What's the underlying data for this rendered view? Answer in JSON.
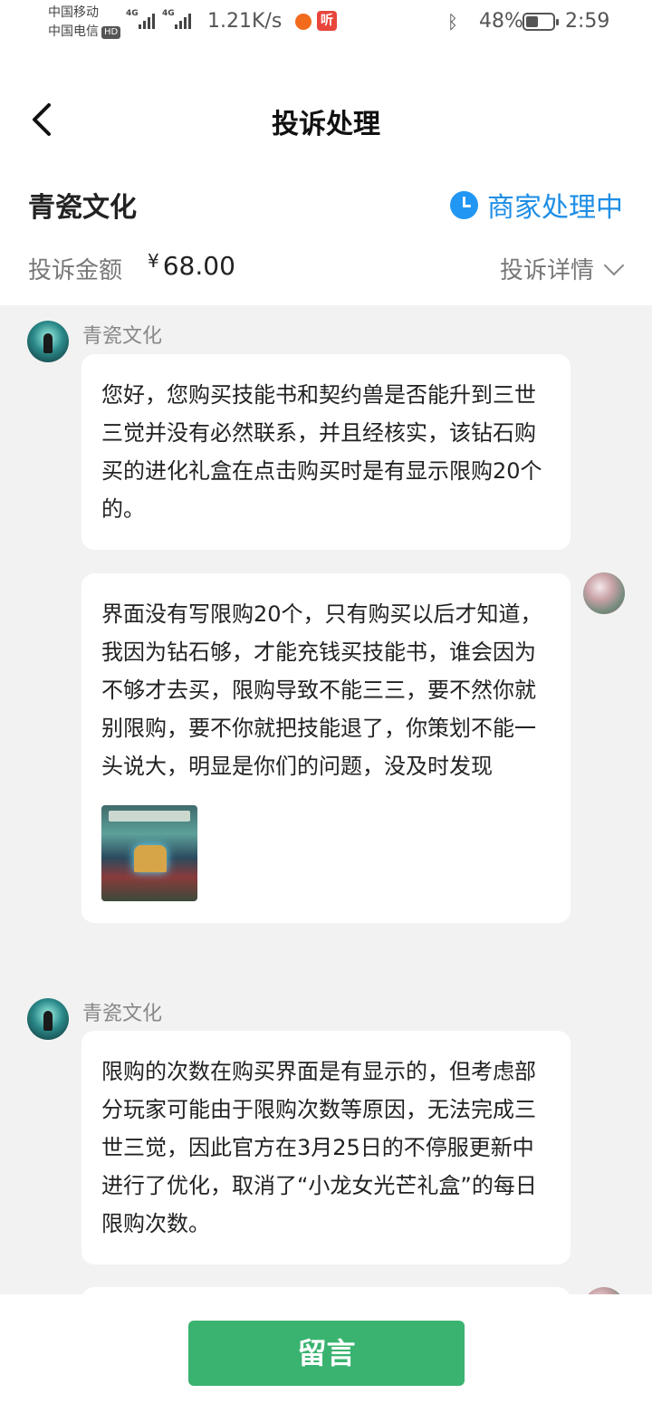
{
  "statusbar": {
    "carrier1": "中国移动",
    "carrier2": "中国电信",
    "hd": "HD",
    "net_tag": "4G",
    "net_speed": "1.21K/s",
    "ting": "听",
    "battery": "48%",
    "battery_level": 0.48,
    "time": "2:59"
  },
  "header": {
    "title": "投诉处理"
  },
  "summary": {
    "merchant": "青瓷文化",
    "status": "商家处理中",
    "status_color": "#1e8ee6",
    "amount_label": "投诉金额",
    "currency": "¥",
    "amount": "68.00",
    "detail_label": "投诉详情"
  },
  "messages": [
    {
      "sender": "青瓷文化",
      "role": "merchant",
      "text": "您好，您购买技能书和契约兽是否能升到三世三觉并没有必然联系，并且经核实，该钻石购买的进化礼盒在点击购买时是有显示限购20个的。"
    },
    {
      "sender": "",
      "role": "user",
      "text": "界面没有写限购20个，只有购买以后才知道，我因为钻石够，才能充钱买技能书，谁会因为不够才去买，限购导致不能三三，要不然你就别限购，要不你就把技能退了，你策划不能一头说大，明显是你们的问题，没及时发现",
      "has_image": true
    },
    {
      "sender": "青瓷文化",
      "role": "merchant",
      "text": "限购的次数在购买界面是有显示的，但考虑部分玩家可能由于限购次数等原因，无法完成三世三觉，因此官方在3月25日的不停服更新中进行了优化，取消了“小龙女光芒礼盒”的每日限购次数。"
    }
  ],
  "footer": {
    "button": "留言",
    "button_color": "#3ab370"
  }
}
